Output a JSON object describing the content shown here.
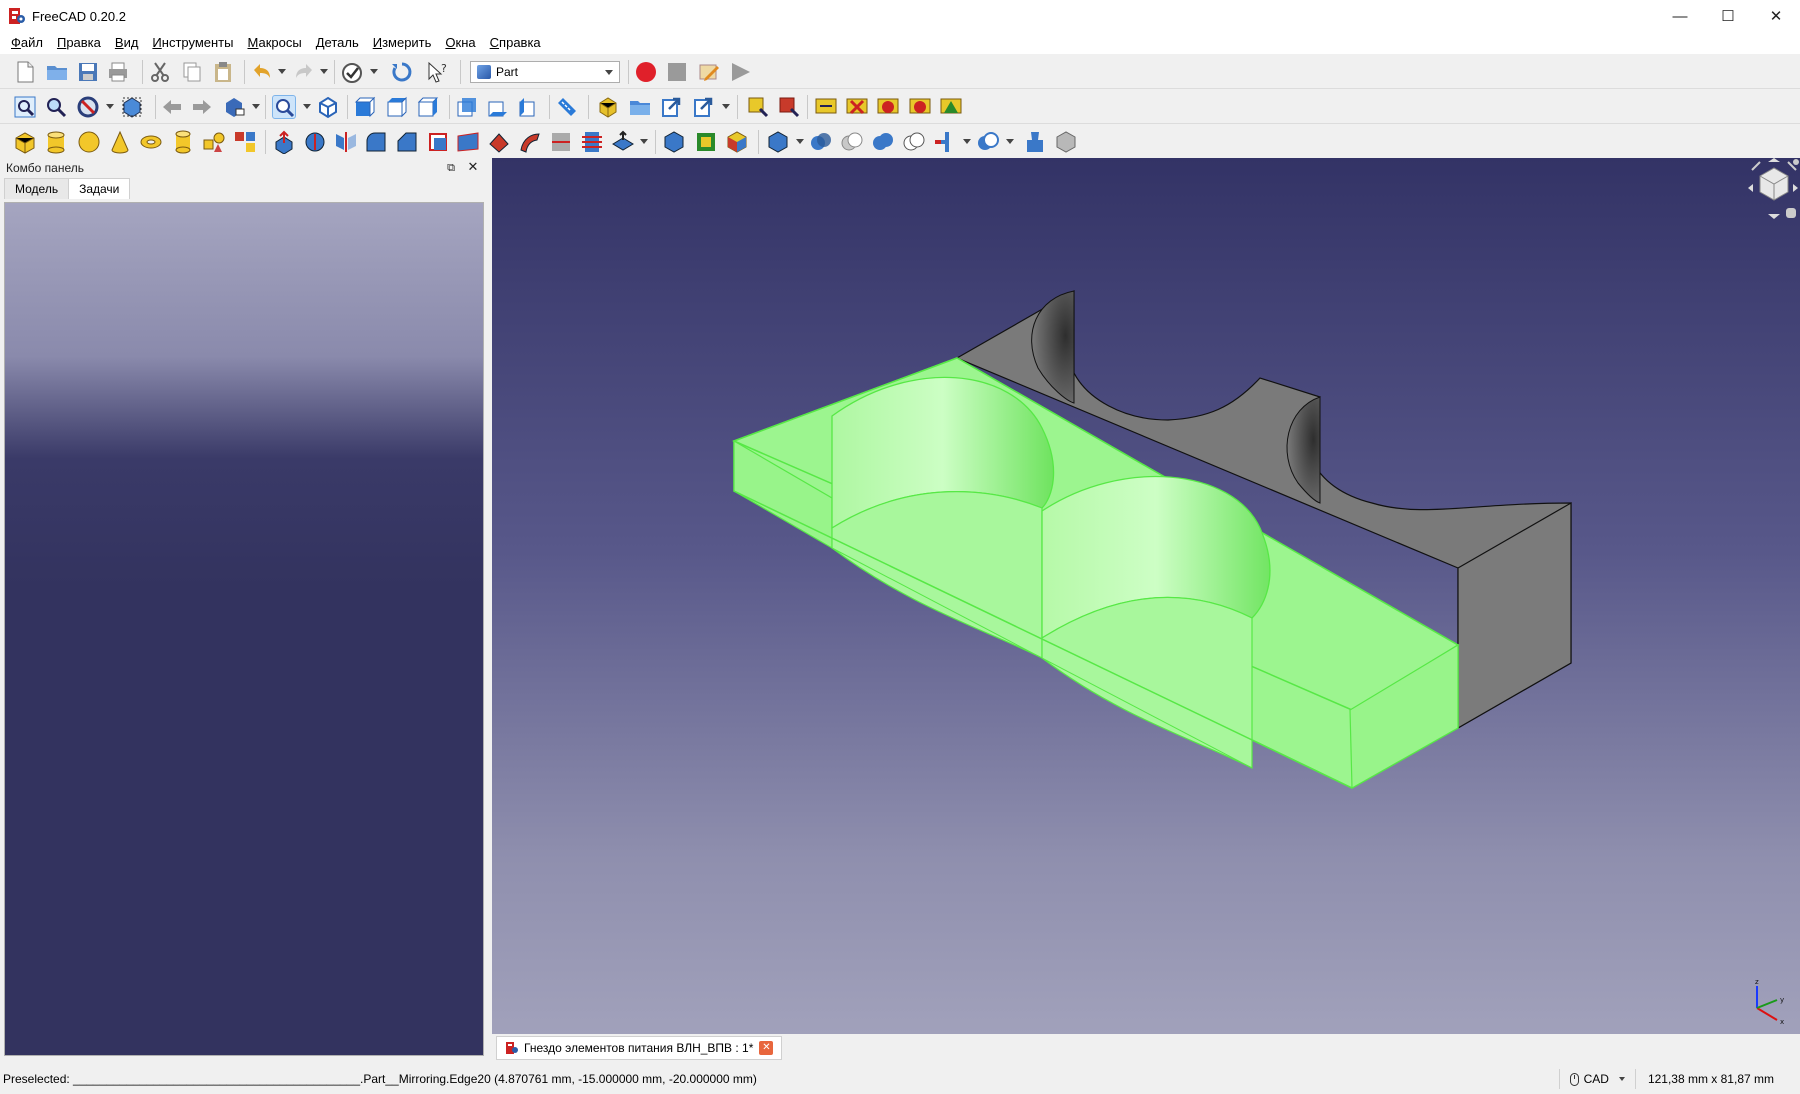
{
  "window": {
    "title": "FreeCAD 0.20.2",
    "controls": [
      "minimize-icon",
      "maximize-icon",
      "close-icon"
    ]
  },
  "menu": {
    "items": [
      {
        "label": "Файл",
        "underline": "Ф",
        "rest": "айл"
      },
      {
        "label": "Правка",
        "underline": "П",
        "rest": "равка"
      },
      {
        "label": "Вид",
        "underline": "В",
        "rest": "ид"
      },
      {
        "label": "Инструменты",
        "underline": "И",
        "rest": "нструменты"
      },
      {
        "label": "Макросы",
        "underline": "М",
        "rest": "акросы"
      },
      {
        "label": "Деталь",
        "underline": "Д",
        "rest": "еталь"
      },
      {
        "label": "Измерить",
        "underline": "И",
        "rest": "змерить"
      },
      {
        "label": "Окна",
        "underline": "О",
        "rest": "кна"
      },
      {
        "label": "Справка",
        "underline": "С",
        "rest": "правка"
      }
    ]
  },
  "toolbar": {
    "workbench": "Part",
    "file_tools": [
      "new-file-icon",
      "open-file-icon",
      "save-icon",
      "print-icon",
      "cut-icon",
      "copy-icon",
      "paste-icon",
      "undo-icon",
      "redo-icon",
      "refresh-icon",
      "whats-this-icon"
    ],
    "macro_tools": [
      "record-macro-icon",
      "stop-macro-icon",
      "edit-macro-icon",
      "run-macro-icon"
    ],
    "view_tools": [
      "fit-all-icon",
      "fit-selection-icon",
      "draw-style-icon",
      "bounding-box-icon",
      "back-icon",
      "forward-icon",
      "link-icon",
      "zoom-icon",
      "isometric-view-icon",
      "front-view-icon",
      "top-view-icon",
      "right-view-icon",
      "rear-view-icon",
      "bottom-view-icon",
      "left-view-icon",
      "measure-icon",
      "part-icon",
      "group-icon",
      "link-make-icon",
      "link-actions-icon",
      "measure-linear-icon",
      "measure-angular-icon",
      "measure-refresh-icon",
      "measure-clear-icon",
      "measure-toggle-all-icon",
      "measure-toggle-3d-icon",
      "measure-toggle-delta-icon"
    ],
    "part_tools": [
      "box-icon",
      "cylinder-icon",
      "sphere-icon",
      "cone-icon",
      "torus-icon",
      "tube-icon",
      "primitives-icon",
      "shape-builder-icon",
      "extrude-icon",
      "revolve-icon",
      "mirror-icon",
      "fillet-icon",
      "chamfer-icon",
      "make-face-icon",
      "ruled-surface-icon",
      "loft-icon",
      "sweep-icon",
      "section-icon",
      "cross-sections-icon",
      "offset-icon",
      "thickness-icon",
      "projection-icon",
      "attachment-icon",
      "compound-icon",
      "boolean-icon",
      "cut-boolean-icon",
      "fuse-icon",
      "common-icon",
      "join-icon",
      "split-icon",
      "check-geometry-icon",
      "defeaturing-icon"
    ]
  },
  "combo_panel": {
    "title": "Комбо панель",
    "tabs": [
      "Модель",
      "Задачи"
    ],
    "active_tab": "Задачи"
  },
  "document": {
    "tab_label": "Гнездо элементов питания ВЛН_ВПВ : 1*"
  },
  "viewport": {
    "highlight_color": "#9cf58f",
    "body_color": "#7d7d7d"
  },
  "status": {
    "preselected": "Preselected: ___________________________________________.Part__Mirroring.Edge20 (4.870761 mm, -15.000000 mm, -20.000000 mm)",
    "nav_style": "CAD",
    "dimensions": "121,38 mm x 81,87 mm"
  }
}
